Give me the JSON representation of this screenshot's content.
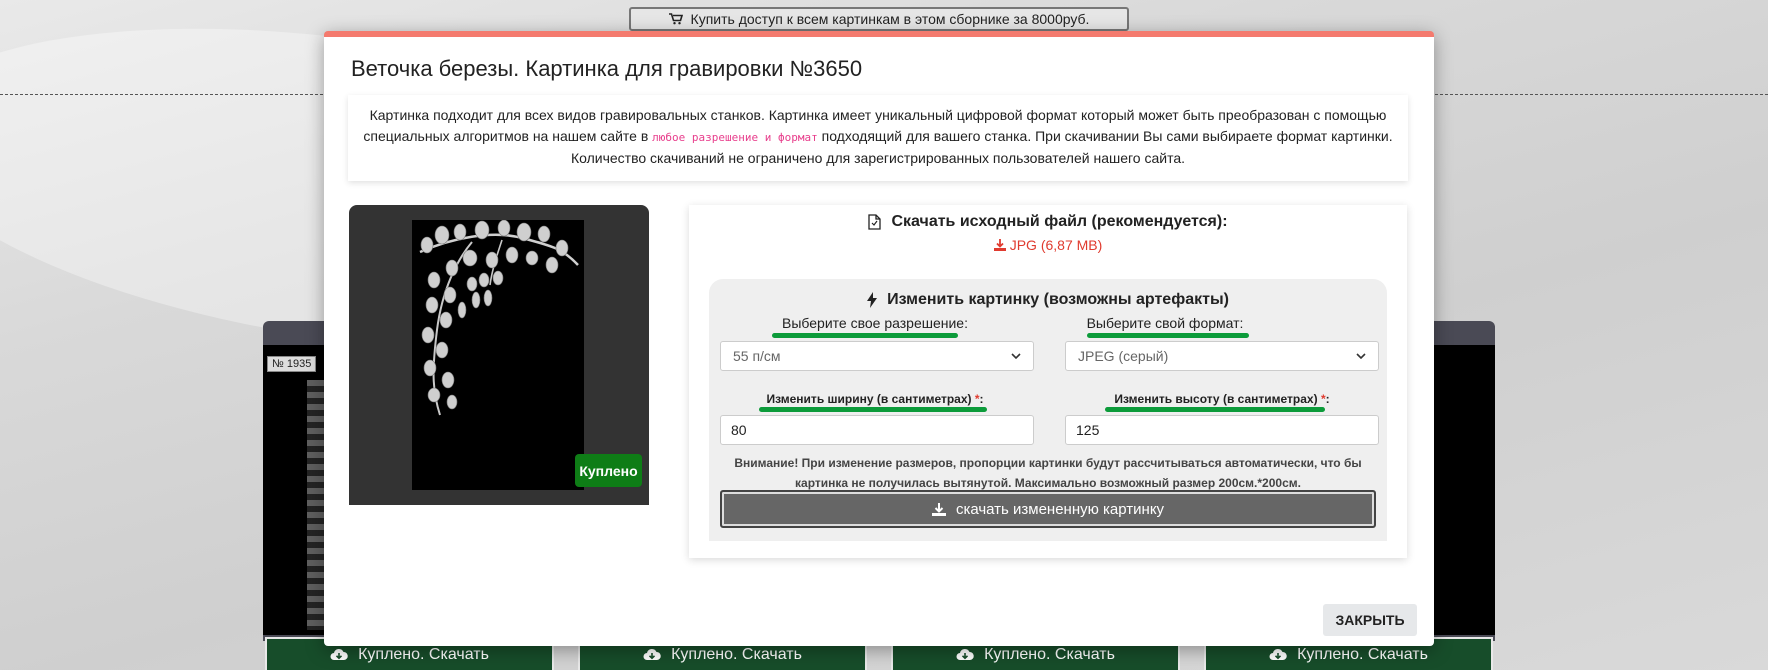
{
  "top_bar": {
    "buy_all_label": "Купить доступ к всем картинкам в этом сборнике за 8000руб.",
    "cart_icon": "cart-icon"
  },
  "gallery": {
    "badge": "№ 1935",
    "buy_buttons": [
      "Куплено. Скачать",
      "Куплено. Скачать",
      "Куплено. Скачать",
      "Куплено. Скачать"
    ],
    "cloud_icon": "cloud-download-icon"
  },
  "modal": {
    "title": "Веточка березы. Картинка для гравировки №3650",
    "accent_color": "#f47a6e",
    "description": {
      "part1": "Картинка подходит для всех видов гравировальных станков. Картинка имеет уникальный цифровой формат который может быть преобразован с помощью специальных алгоритмов на нашем сайте в",
      "link": "любое разрешение и формат",
      "part2": "подходящий для вашего станка. При скачивании Вы сами выбираете формат картинки. Количество скачиваний не ограничено для зарегистрированных пользователей нашего сайта."
    },
    "preview": {
      "purchased_label": "Куплено"
    },
    "original": {
      "heading": "Скачать исходный файл (рекомендуется):",
      "file_link": "JPG (6,87 MB)",
      "file_icon": "file-icon",
      "download_icon": "download-icon"
    },
    "modify": {
      "heading": "Изменить картинку (возможны артефакты)",
      "bolt_icon": "bolt-icon",
      "resolution_label": "Выберите свое разрешение:",
      "resolution_value": "55 п/см",
      "format_label": "Выберите свой формат:",
      "format_value": "JPEG (серый)",
      "width_label": "Изменить ширину (в сантиметрах)",
      "width_value": "80",
      "height_label": "Изменить высоту (в сантиметрах)",
      "height_value": "125",
      "required_mark": "*",
      "colon": ":",
      "warning": "Внимание! При изменение размеров, пропорции картинки будут рассчитываться автоматически, что бы картинка не получилась вытянутой. Максимально возможный размер 200см.*200см.",
      "download_button": "скачать измененную картинку",
      "highlight_color": "#0c9b3a"
    },
    "close_label": "ЗАКРЫТЬ"
  }
}
